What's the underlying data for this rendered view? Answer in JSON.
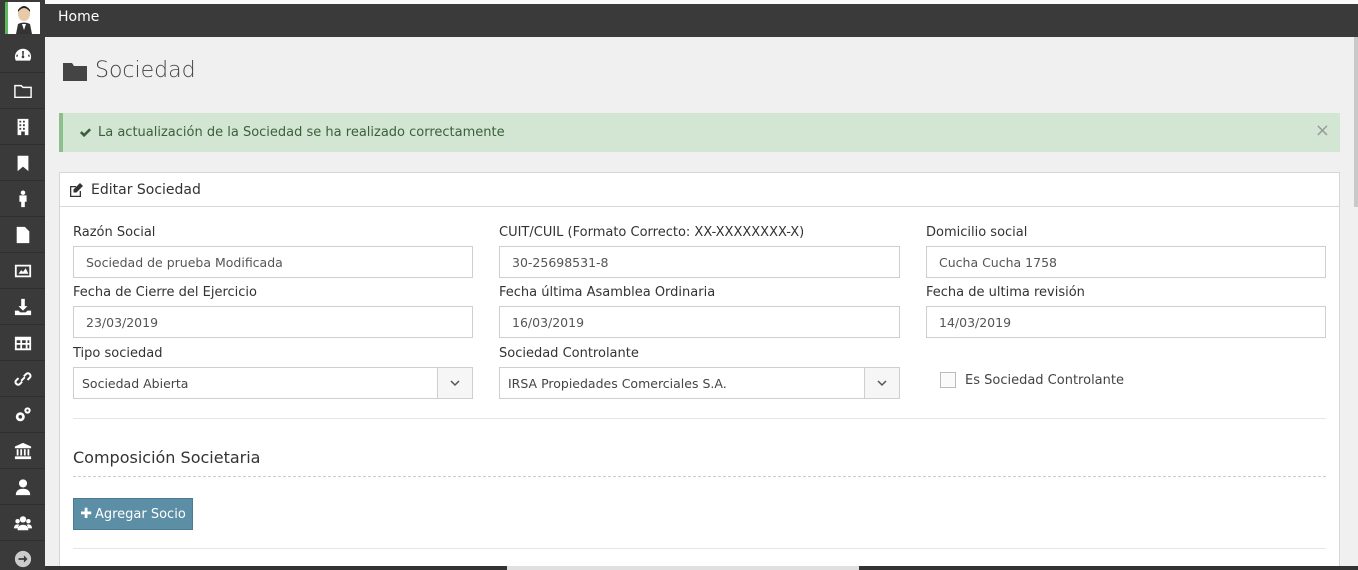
{
  "topbar": {
    "home_label": "Home"
  },
  "page": {
    "title": "Sociedad"
  },
  "alert": {
    "message": "La actualización de la Sociedad se ha realizado correctamente",
    "close": "×"
  },
  "panel": {
    "title": "Editar Sociedad"
  },
  "form": {
    "razon_social": {
      "label": "Razón Social",
      "value": "Sociedad de prueba Modificada"
    },
    "cuit": {
      "label": "CUIT/CUIL (Formato Correcto: XX-XXXXXXXX-X)",
      "value": "30-25698531-8"
    },
    "domicilio": {
      "label": "Domicilio social",
      "value": "Cucha Cucha 1758"
    },
    "fecha_cierre": {
      "label": "Fecha de Cierre del Ejercicio",
      "value": "23/03/2019"
    },
    "fecha_asamblea": {
      "label": "Fecha última Asamblea Ordinaria",
      "value": "16/03/2019"
    },
    "fecha_revision": {
      "label": "Fecha de ultima revisión",
      "value": "14/03/2019"
    },
    "tipo_sociedad": {
      "label": "Tipo sociedad",
      "value": "Sociedad Abierta"
    },
    "sociedad_controlante": {
      "label": "Sociedad Controlante",
      "value": "IRSA Propiedades Comerciales S.A."
    },
    "es_controlante": {
      "label": "Es Sociedad Controlante",
      "checked": false
    }
  },
  "composicion": {
    "title": "Composición Societaria",
    "add_button": "Agregar Socio"
  },
  "sidebar": {
    "items": [
      "dashboard-icon",
      "folder-icon",
      "building-icon",
      "bookmark-icon",
      "person-icon",
      "document-icon",
      "image-icon",
      "download-icon",
      "table-icon",
      "link-icon",
      "cogs-icon",
      "bank-icon",
      "user-icon",
      "users-icon",
      "arrow-right-icon"
    ]
  },
  "colors": {
    "sidebar": "#3a3a3a",
    "alert_bg": "#d3e6d3",
    "button": "#5c8ea5"
  }
}
